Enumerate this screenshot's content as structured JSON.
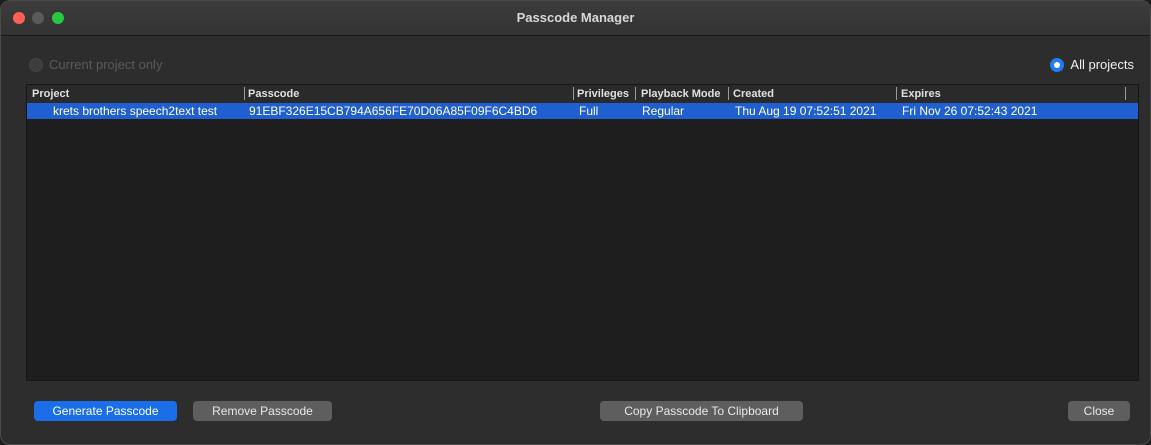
{
  "window": {
    "title": "Passcode Manager"
  },
  "filter": {
    "current_project_label": "Current project only",
    "all_projects_label": "All projects",
    "selected": "all"
  },
  "table": {
    "columns": [
      "Project",
      "Passcode",
      "Privileges",
      "Playback Mode",
      "Created",
      "Expires"
    ],
    "rows": [
      {
        "project": "krets brothers speech2text test",
        "passcode": "91EBF326E15CB794A656FE70D06A85F09F6C4BD6",
        "privileges": "Full",
        "playback_mode": "Regular",
        "created": "Thu Aug 19 07:52:51 2021",
        "expires": "Fri Nov 26 07:52:43 2021",
        "selected": true
      }
    ]
  },
  "buttons": {
    "generate": "Generate Passcode",
    "remove": "Remove Passcode",
    "copy": "Copy Passcode To Clipboard",
    "close": "Close"
  },
  "colors": {
    "accent": "#1a6ee8",
    "selection": "#1f5fcf",
    "close_light": "#ff5f57",
    "zoom_light": "#28c840"
  }
}
